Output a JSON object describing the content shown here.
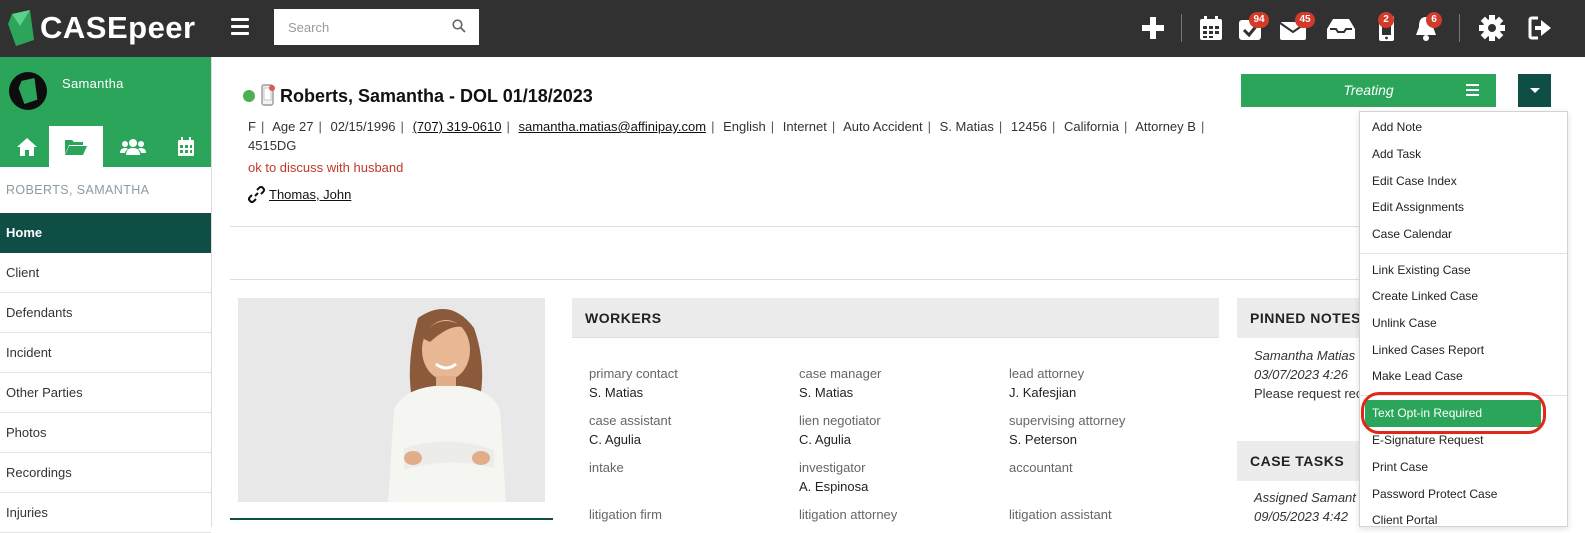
{
  "app": {
    "brand": "CASEpeer",
    "search_placeholder": "Search"
  },
  "topbar": {
    "badges": {
      "tasks": "94",
      "mail": "45",
      "mobile": "2",
      "notifications": "6"
    }
  },
  "sidebar": {
    "user": "Samantha",
    "case_label": "ROBERTS, SAMANTHA",
    "items": [
      "Home",
      "Client",
      "Defendants",
      "Incident",
      "Other Parties",
      "Photos",
      "Recordings",
      "Injuries"
    ]
  },
  "case": {
    "title": "Roberts, Samantha - DOL 01/18/2023",
    "info": {
      "sex": "F",
      "age": "Age 27",
      "dob": "02/15/1996",
      "phone": "(707) 319-0610",
      "email": "samantha.matias@affinipay.com",
      "language": "English",
      "source": "Internet",
      "case_type": "Auto Accident",
      "attorney_initials": "S. Matias",
      "zip": "12456",
      "state": "California",
      "attorney": "Attorney B",
      "code": "4515DG"
    },
    "note": "ok to discuss with husband",
    "linked_contact": "Thomas, John",
    "status": "Treating"
  },
  "workers": {
    "header": "WORKERS",
    "items": [
      {
        "label": "primary contact",
        "value": "S. Matias"
      },
      {
        "label": "case manager",
        "value": "S. Matias"
      },
      {
        "label": "lead attorney",
        "value": "J. Kafesjian"
      },
      {
        "label": "case assistant",
        "value": "C. Agulia"
      },
      {
        "label": "lien negotiator",
        "value": "C. Agulia"
      },
      {
        "label": "supervising attorney",
        "value": "S. Peterson"
      },
      {
        "label": "intake",
        "value": ""
      },
      {
        "label": "investigator",
        "value": "A. Espinosa"
      },
      {
        "label": "accountant",
        "value": ""
      },
      {
        "label": "litigation firm",
        "value": ""
      },
      {
        "label": "litigation attorney",
        "value": ""
      },
      {
        "label": "litigation assistant",
        "value": ""
      }
    ]
  },
  "pinned": {
    "header": "PINNED NOTES",
    "author": "Samantha Matias",
    "date": "03/07/2023 4:26",
    "text": "Please request rec"
  },
  "tasks": {
    "header": "CASE TASKS",
    "line1": "Assigned Samant",
    "line2": "09/05/2023 4:42"
  },
  "menu": {
    "items": [
      "Add Note",
      "Add Task",
      "Edit Case Index",
      "Edit Assignments",
      "Case Calendar",
      "Link Existing Case",
      "Create Linked Case",
      "Unlink Case",
      "Linked Cases Report",
      "Make Lead Case",
      "Text Opt-in Required",
      "E-Signature Request",
      "Print Case",
      "Password Protect Case",
      "Client Portal"
    ],
    "highlighted": "Text Opt-in Required"
  },
  "colors": {
    "brand_green": "#2aa55a",
    "dark_teal": "#0f4e45",
    "topbar": "#313131",
    "alert_red": "#e02718"
  }
}
